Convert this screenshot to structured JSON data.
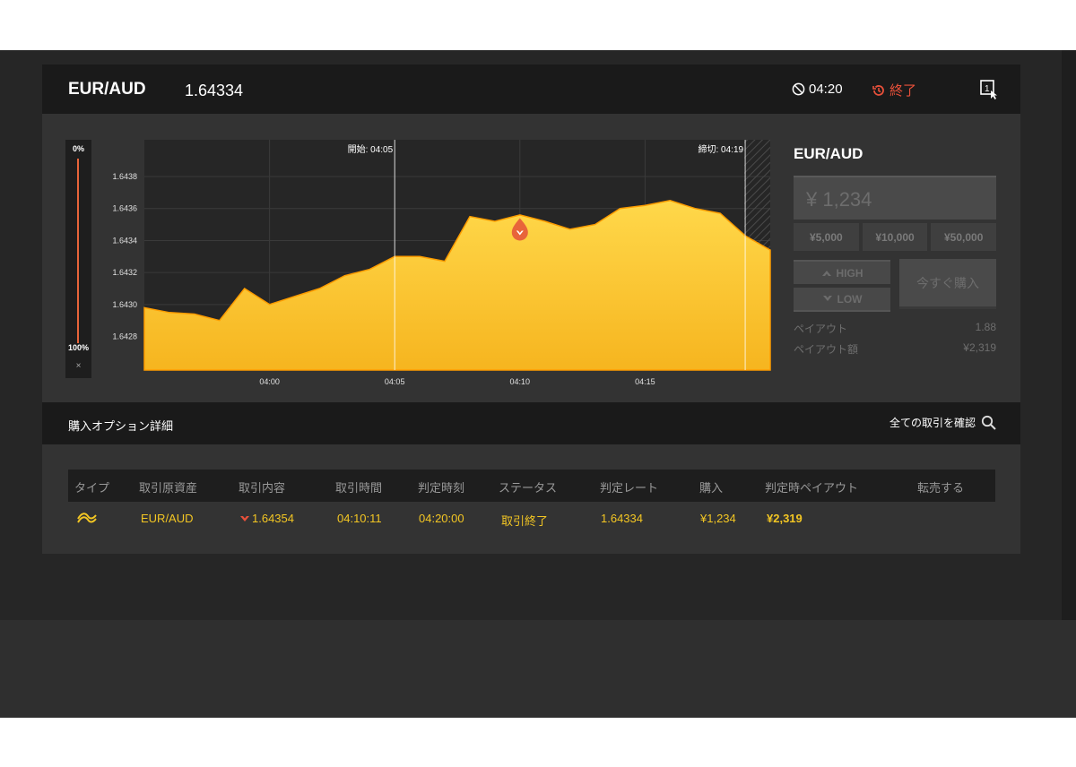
{
  "header": {
    "pair": "EUR/AUD",
    "rate": "1.64334",
    "timer": "04:20",
    "status": "終了"
  },
  "slider": {
    "top_label": "0%",
    "bottom_label": "100%",
    "close": "×"
  },
  "chart_data": {
    "type": "area",
    "start_label": "開始: 04:05",
    "end_label": "締切: 04:19",
    "x_ticks": [
      "04:00",
      "04:05",
      "04:10",
      "04:15"
    ],
    "y_ticks": [
      "1.6438",
      "1.6436",
      "1.6434",
      "1.6432",
      "1.6430",
      "1.6428"
    ],
    "ylim": [
      1.64259,
      1.64403
    ],
    "x_range": [
      "03:55",
      "04:20"
    ],
    "series": [
      {
        "x": [
          "03:55",
          "03:56",
          "03:57",
          "03:58",
          "03:59",
          "04:00",
          "04:01",
          "04:02",
          "04:03",
          "04:04",
          "04:05",
          "04:06",
          "04:07",
          "04:08",
          "04:09",
          "04:10",
          "04:11",
          "04:12",
          "04:13",
          "04:14",
          "04:15",
          "04:16",
          "04:17",
          "04:18",
          "04:19",
          "04:20"
        ],
        "values": [
          1.64298,
          1.64295,
          1.64294,
          1.6429,
          1.6431,
          1.643,
          1.64305,
          1.6431,
          1.64318,
          1.64322,
          1.6433,
          1.6433,
          1.64327,
          1.64355,
          1.64352,
          1.64356,
          1.64352,
          1.64347,
          1.6435,
          1.6436,
          1.64362,
          1.64365,
          1.6436,
          1.64357,
          1.64343,
          1.64334
        ]
      }
    ],
    "marker": {
      "x": "04:10",
      "value": 1.64354
    },
    "colors": {
      "fill_top": "#ffd84a",
      "fill_bottom": "#f6b51f",
      "line": "#ff9d00",
      "marker": "#e8643a",
      "bg": "#262626",
      "expired_bg": "#2c2c2c"
    }
  },
  "trade": {
    "pair": "EUR/AUD",
    "amount": "¥ 1,234",
    "presets": [
      "¥5,000",
      "¥10,000",
      "¥50,000"
    ],
    "high": "HIGH",
    "low": "LOW",
    "buy": "今すぐ購入",
    "payout_label": "ペイアウト",
    "payout_value": "1.88",
    "payout_amount_label": "ペイアウト額",
    "payout_amount_value": "¥2,319"
  },
  "options": {
    "title": "購入オプション詳細",
    "link": "全ての取引を確認"
  },
  "table": {
    "headers": [
      "タイプ",
      "取引原資産",
      "取引内容",
      "取引時間",
      "判定時刻",
      "ステータス",
      "判定レート",
      "購入",
      "判定時ペイアウト",
      "転売する"
    ],
    "row": {
      "asset": "EUR/AUD",
      "content": "1.64354",
      "trade_time": "04:10:11",
      "judge_time": "04:20:00",
      "status": "取引終了",
      "judge_rate": "1.64334",
      "purchase": "¥1,234",
      "payout": "¥2,319"
    }
  },
  "colors": {
    "accent": "#f3c623",
    "alert": "#e8503a"
  }
}
